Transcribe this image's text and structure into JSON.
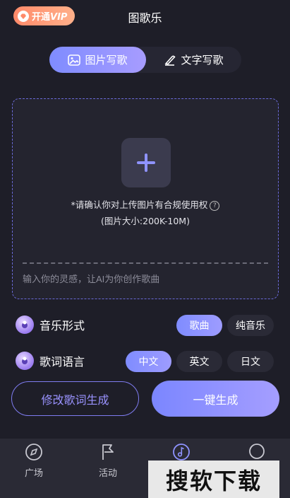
{
  "header": {
    "vip_label_prefix": "开通",
    "vip_label_suffix": "VIP",
    "title": "图歌乐"
  },
  "mode_tabs": [
    {
      "label": "图片写歌",
      "active": true,
      "icon": "image-icon"
    },
    {
      "label": "文字写歌",
      "active": false,
      "icon": "pen-icon"
    }
  ],
  "upload": {
    "notice": "*请确认你对上传图片有合规使用权",
    "size_hint": "(图片大小:200K-10M)",
    "inspiration_placeholder": "输入你的灵感，让AI为你创作歌曲"
  },
  "music_form": {
    "label": "音乐形式",
    "options": [
      "歌曲",
      "纯音乐"
    ],
    "selected": "歌曲"
  },
  "lyric_lang": {
    "label": "歌词语言",
    "options": [
      "中文",
      "英文",
      "日文"
    ],
    "selected": "中文"
  },
  "actions": {
    "edit_lyrics": "修改歌词生成",
    "one_click": "一键生成"
  },
  "nav": [
    {
      "label": "广场",
      "icon": "compass-icon"
    },
    {
      "label": "活动",
      "icon": "flag-icon"
    },
    {
      "label": "",
      "icon": "music-note-icon"
    },
    {
      "label": "",
      "icon": "profile-icon"
    }
  ],
  "watermark": "搜软下载",
  "colors": {
    "accent": "#8f93ff",
    "background": "#1e1e28",
    "vip": "#ff9a78"
  }
}
